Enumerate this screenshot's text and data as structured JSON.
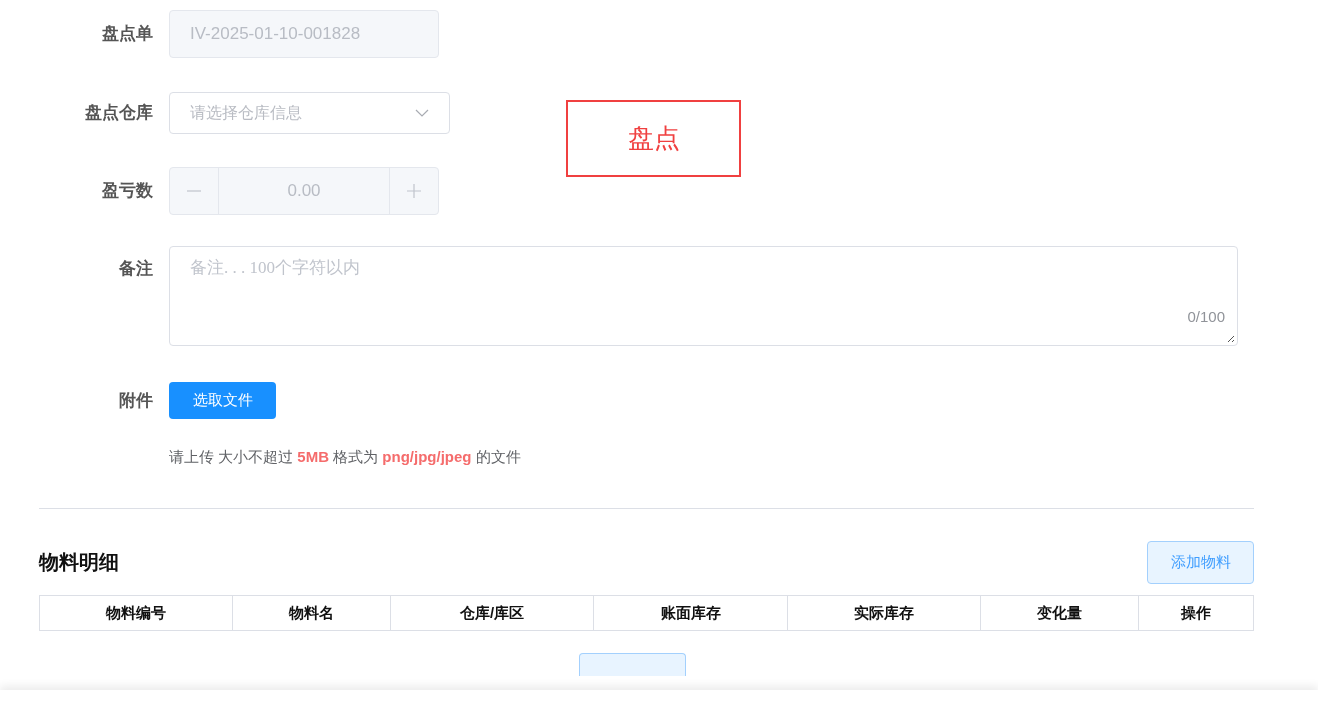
{
  "form": {
    "fields": [
      {
        "kind": "text",
        "label": "盘点单",
        "value": "IV-2025-01-10-001828",
        "disabled": true
      },
      {
        "kind": "select",
        "label": "盘点仓库",
        "placeholder": "请选择仓库信息"
      },
      {
        "kind": "number",
        "label": "盈亏数",
        "value": "0.00",
        "disabled": true
      },
      {
        "kind": "textarea",
        "label": "备注",
        "placeholder": "备注. . . 100个字符以内",
        "counter": "0/100"
      },
      {
        "kind": "upload",
        "label": "附件",
        "button": "选取文件",
        "hint": "请上传 大小不超过 **5MB** 格式为 **png/jpg/jpeg** 的文件"
      }
    ]
  },
  "stamp": "盘点",
  "materials": {
    "title": "物料明细",
    "add_button": "添加物料",
    "columns": [
      "物料编号",
      "物料名",
      "仓库/库区",
      "账面库存",
      "实际库存",
      "变化量",
      "操作"
    ]
  }
}
